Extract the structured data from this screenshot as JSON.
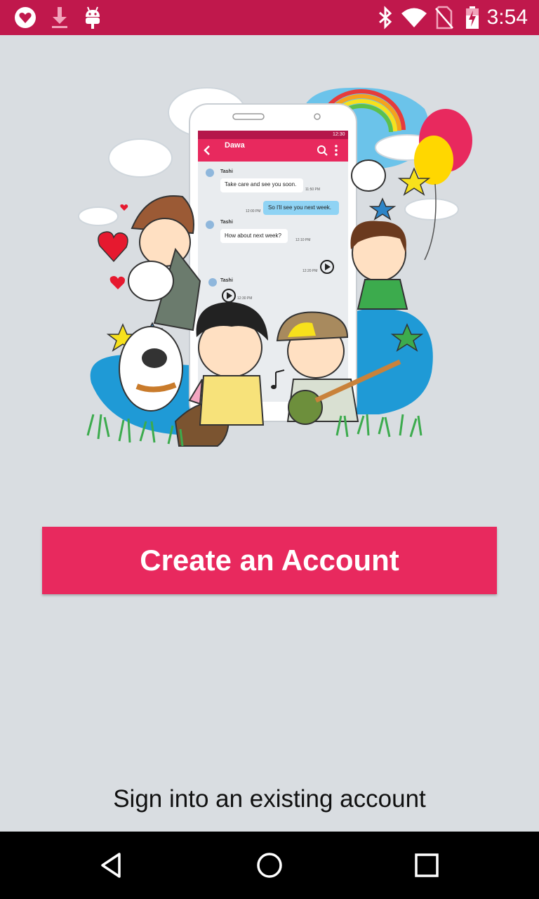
{
  "status_bar": {
    "time": "3:54",
    "background": "#c0184c",
    "left_icons": [
      "app-heart-icon",
      "download-icon",
      "android-icon"
    ],
    "right_icons": [
      "bluetooth-icon",
      "wifi-icon",
      "no-sim-icon",
      "battery-icon"
    ]
  },
  "illustration": {
    "chat": {
      "header_title": "Dawa",
      "status_time": "12:30",
      "messages": [
        {
          "sender": "Tashi",
          "text": "Take care and see you soon.",
          "time": "11:50 PM"
        },
        {
          "text": "So I'll see you next week.",
          "time": "12:00 PM"
        },
        {
          "sender": "Tashi",
          "text": "How about next week?",
          "time": "12:10 PM"
        },
        {
          "time": "12:20 PM"
        },
        {
          "sender": "Tashi",
          "time": "12:30 PM"
        }
      ]
    }
  },
  "create_account_label": "Create an Account",
  "sign_in_label": "Sign into an existing account",
  "colors": {
    "accent": "#e8295e",
    "background": "#d9dde1",
    "nav_bar": "#000000"
  },
  "nav_bar": {
    "icons": [
      "back-icon",
      "home-icon",
      "recents-icon"
    ]
  }
}
